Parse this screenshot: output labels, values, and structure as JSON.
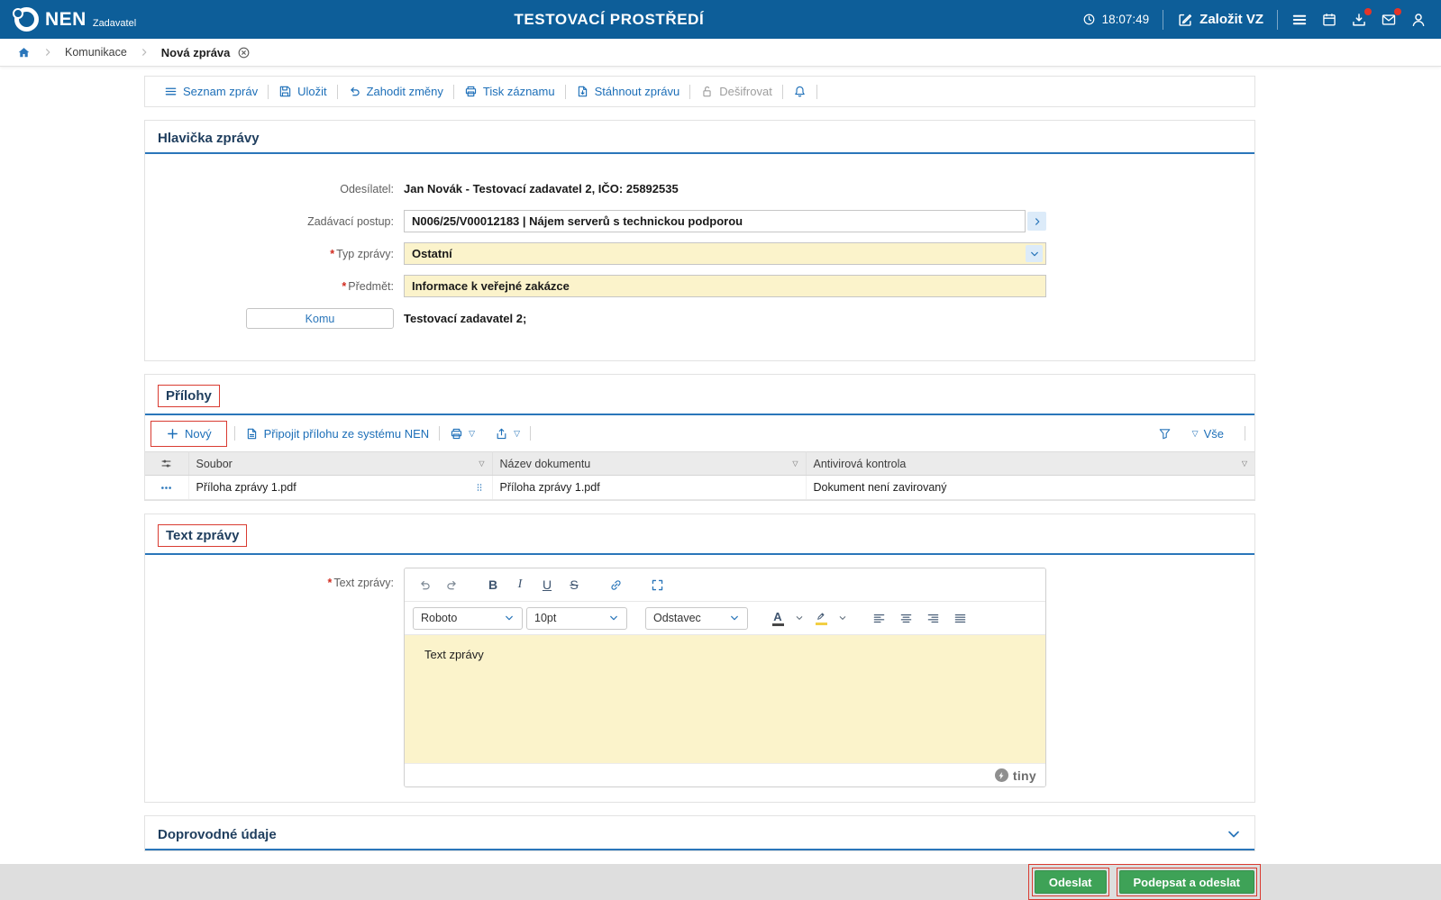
{
  "topbar": {
    "brand": "NEN",
    "brand_sub": "Zadavatel",
    "environment": "TESTOVACÍ PROSTŘEDÍ",
    "time": "18:07:49",
    "new_vz_label": "Založit VZ"
  },
  "breadcrumb": {
    "section": "Komunikace",
    "current": "Nová zpráva"
  },
  "actions": {
    "items": [
      {
        "label": "Seznam zpráv"
      },
      {
        "label": "Uložit"
      },
      {
        "label": "Zahodit změny"
      },
      {
        "label": "Tisk záznamu"
      },
      {
        "label": "Stáhnout zprávu"
      },
      {
        "label": "Dešifrovat"
      }
    ]
  },
  "message_header": {
    "title": "Hlavička zprávy",
    "sender_label": "Odesílatel:",
    "sender_value": "Jan Novák - Testovací zadavatel 2, IČO: 25892535",
    "procedure_label": "Zadávací postup:",
    "procedure_value": "N006/25/V00012183 | Nájem serverů s technickou podporou",
    "type_label": "Typ zprávy:",
    "type_value": "Ostatní",
    "subject_label": "Předmět:",
    "subject_value": "Informace k veřejné zakázce",
    "to_button_label": "Komu",
    "to_value": "Testovací zadavatel 2;"
  },
  "attachments": {
    "title": "Přílohy",
    "new_label": "Nový",
    "attach_label": "Připojit přílohu ze systému NEN",
    "filter_all_label": "Vše",
    "columns": {
      "file": "Soubor",
      "doc_name": "Název dokumentu",
      "antivirus": "Antivirová kontrola"
    },
    "rows": [
      {
        "file": "Příloha zprávy 1.pdf",
        "doc_name": "Příloha zprávy 1.pdf",
        "antivirus": "Dokument není zavirovaný"
      }
    ]
  },
  "message_text": {
    "title": "Text zprávy",
    "label": "Text zprávy:",
    "editor": {
      "font": "Roboto",
      "font_size": "10pt",
      "block": "Odstavec",
      "bold": "B",
      "italic": "I",
      "underline": "U",
      "strike": "S",
      "forecolor": "A",
      "content": "Text zprávy",
      "brand": "tiny"
    }
  },
  "additional_section": {
    "title": "Doprovodné údaje"
  },
  "footer": {
    "send_label": "Odeslat",
    "sign_send_label": "Podepsat a odeslat"
  },
  "glyphs": {
    "required": "*",
    "filter_triangle": "▽"
  },
  "colors": {
    "header_blue": "#0d5e99",
    "link_blue": "#1d6fb8",
    "accent_blue": "#2a76ba",
    "field_yellow": "#fbf3cb",
    "green_button": "#3ea257",
    "annotation_red": "#d93b31",
    "badge_red": "#e53528"
  }
}
